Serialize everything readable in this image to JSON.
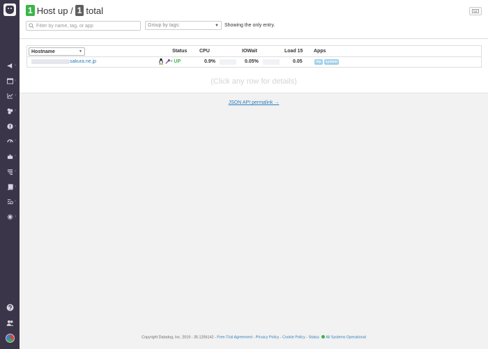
{
  "header": {
    "up_count": "1",
    "title_middle": "Host up /",
    "total_count": "1",
    "title_end": "total"
  },
  "filters": {
    "search_placeholder": "Filter by name, tag, or app",
    "group_placeholder": "Group by tags:",
    "showing_text": "Showing the only entry."
  },
  "table": {
    "columns": {
      "hostname": "Hostname",
      "status": "Status",
      "cpu": "CPU",
      "iowait": "IOWait",
      "load15": "Load 15",
      "apps": "Apps"
    },
    "rows": [
      {
        "hostname_suffix": ".sakura.ne.jp",
        "status": "• UP",
        "cpu": "0.9%",
        "iowait": "0.05%",
        "load15": "0.05",
        "apps": [
          "ntp",
          "system"
        ]
      }
    ],
    "click_hint": "(Click any row for details)"
  },
  "json_link": "JSON API permalink →",
  "footer": {
    "copyright": "Copyright Datadog, Inc. 2019 - 35.1256142 -",
    "free_trial": "Free-Trial Agreement",
    "privacy": "Privacy Policy",
    "cookie": "Cookie Policy",
    "status": "Status",
    "operational": "All Systems Operational"
  },
  "sidebar": {
    "icons": [
      "megaphone-icon",
      "dashboard-icon",
      "chart-icon",
      "infrastructure-icon",
      "monitors-icon",
      "apm-icon",
      "integrations-icon",
      "logs-icon",
      "notebooks-icon",
      "synthetics-icon",
      "security-icon"
    ],
    "bottom_icons": [
      "help-icon",
      "team-icon",
      "avatar"
    ]
  },
  "colors": {
    "sidebar": "#3b3549",
    "up_green": "#3bb54a",
    "link_blue": "#2b7bb9",
    "app_tag": "#9fd0ea"
  }
}
